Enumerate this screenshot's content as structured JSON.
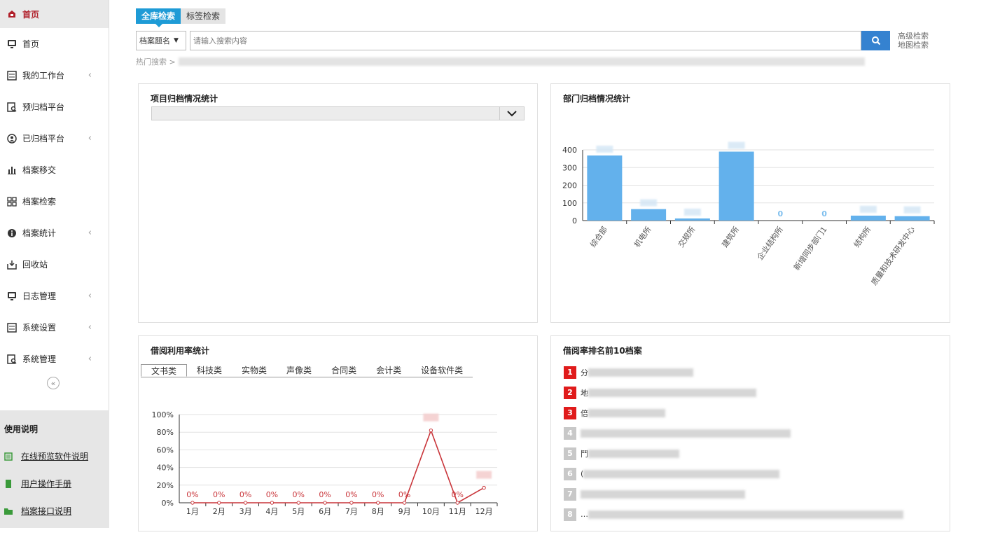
{
  "sidebar": {
    "top_label": "首页",
    "items": [
      {
        "label": "首页",
        "icon": "monitor-icon",
        "chevron": false
      },
      {
        "label": "我的工作台",
        "icon": "list-icon",
        "chevron": true
      },
      {
        "label": "预归档平台",
        "icon": "doc-search-icon",
        "chevron": false
      },
      {
        "label": "已归档平台",
        "icon": "user-circle-icon",
        "chevron": true
      },
      {
        "label": "档案移交",
        "icon": "bar-chart-icon",
        "chevron": false
      },
      {
        "label": "档案检索",
        "icon": "grid-icon",
        "chevron": false
      },
      {
        "label": "档案统计",
        "icon": "info-icon",
        "chevron": true
      },
      {
        "label": "回收站",
        "icon": "inbox-icon",
        "chevron": false
      },
      {
        "label": "日志管理",
        "icon": "monitor-icon",
        "chevron": true
      },
      {
        "label": "系统设置",
        "icon": "list-icon",
        "chevron": true
      },
      {
        "label": "系统管理",
        "icon": "doc-search-icon",
        "chevron": true
      }
    ],
    "collapse_symbol": "«",
    "help": {
      "title": "使用说明",
      "links": [
        "在线预览软件说明",
        "用户操作手册",
        "档案接口说明"
      ]
    }
  },
  "search": {
    "tab_all": "全库检索",
    "tab_tag": "标签检索",
    "field_select": "档案题名",
    "placeholder": "请输入搜索内容",
    "advanced": "高级检索",
    "map": "地图检索",
    "hot_label": "热门搜索 >"
  },
  "panels": {
    "project_stats": {
      "title": "项目归档情况统计"
    },
    "dept_stats": {
      "title": "部门归档情况统计"
    },
    "borrow_stats": {
      "title": "借阅利用率统计",
      "tabs": [
        "文书类",
        "科技类",
        "实物类",
        "声像类",
        "合同类",
        "会计类",
        "设备软件类"
      ]
    },
    "top10": {
      "title": "借阅率排名前10档案"
    }
  },
  "ranking": [
    {
      "num": "1",
      "text": "分"
    },
    {
      "num": "2",
      "text": "地"
    },
    {
      "num": "3",
      "text": "倍"
    },
    {
      "num": "4",
      "text": ""
    },
    {
      "num": "5",
      "text": "鬥"
    },
    {
      "num": "6",
      "text": "("
    },
    {
      "num": "7",
      "text": ""
    },
    {
      "num": "8",
      "text": "…"
    }
  ],
  "colors": {
    "accent": "#1e9bd6",
    "bar": "#63b1ec",
    "line": "#c9353a",
    "rank_red": "#e01b1b",
    "rank_gray": "#c8c8c8"
  },
  "chart_data": [
    {
      "type": "bar",
      "title": "部门归档情况统计",
      "categories": [
        "综合部",
        "机电所",
        "交规所",
        "建筑所",
        "企业结构所",
        "新增同步部门1",
        "结构所",
        "质量和技术研发中心"
      ],
      "values": [
        368,
        65,
        12,
        390,
        0,
        0,
        28,
        25
      ],
      "value_labels": [
        "",
        "",
        "",
        "",
        "0",
        "0",
        "",
        ""
      ],
      "ylim": [
        0,
        400
      ],
      "yticks": [
        0,
        100,
        200,
        300,
        400
      ]
    },
    {
      "type": "line",
      "title": "借阅利用率统计",
      "categories": [
        "1月",
        "2月",
        "3月",
        "4月",
        "5月",
        "6月",
        "7月",
        "8月",
        "9月",
        "10月",
        "11月",
        "12月"
      ],
      "values": [
        0,
        0,
        0,
        0,
        0,
        0,
        0,
        0,
        0,
        82,
        0,
        17
      ],
      "value_labels": [
        "0%",
        "0%",
        "0%",
        "0%",
        "0%",
        "0%",
        "0%",
        "0%",
        "0%",
        "",
        "0%",
        ""
      ],
      "ylim": [
        0,
        100
      ],
      "yticks": [
        "0%",
        "20%",
        "40%",
        "60%",
        "80%",
        "100%"
      ]
    }
  ]
}
